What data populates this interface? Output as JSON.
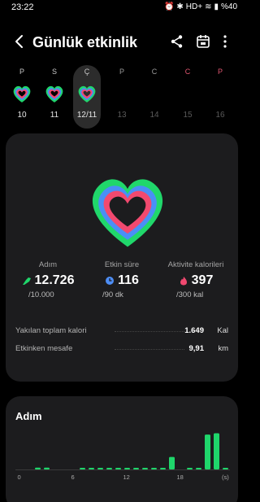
{
  "status": {
    "time": "23:22",
    "network": "HD+",
    "battery": "%40"
  },
  "header": {
    "title": "Günlük etkinlik"
  },
  "week": [
    {
      "letter": "P",
      "num": "10",
      "has_ring": true,
      "selected": false,
      "future": false,
      "weekend": false
    },
    {
      "letter": "S",
      "num": "11",
      "has_ring": true,
      "selected": false,
      "future": false,
      "weekend": false
    },
    {
      "letter": "Ç",
      "num": "12/11",
      "has_ring": true,
      "selected": true,
      "future": false,
      "weekend": false
    },
    {
      "letter": "P",
      "num": "13",
      "has_ring": false,
      "selected": false,
      "future": true,
      "weekend": false
    },
    {
      "letter": "C",
      "num": "14",
      "has_ring": false,
      "selected": false,
      "future": true,
      "weekend": false
    },
    {
      "letter": "C",
      "num": "15",
      "has_ring": false,
      "selected": false,
      "future": true,
      "weekend": true
    },
    {
      "letter": "P",
      "num": "16",
      "has_ring": false,
      "selected": false,
      "future": true,
      "weekend": true
    }
  ],
  "stats": {
    "steps": {
      "label": "Adım",
      "value": "12.726",
      "goal": "/10.000"
    },
    "active_time": {
      "label": "Etkin süre",
      "value": "116",
      "goal": "/90 dk"
    },
    "active_calories": {
      "label": "Aktivite kalorileri",
      "value": "397",
      "goal": "/300 kal"
    }
  },
  "rows": [
    {
      "label": "Yakılan toplam kalori",
      "value": "1.649",
      "unit": "Kal"
    },
    {
      "label": "Etkinken mesafe",
      "value": "9,91",
      "unit": "km"
    }
  ],
  "steps_card": {
    "title": "Adım"
  },
  "colors": {
    "steps_green": "#1fd66b",
    "active_blue": "#4d8df5",
    "calories_pink": "#f0486f"
  },
  "chart_data": {
    "type": "bar",
    "x": [
      0,
      1,
      2,
      3,
      4,
      5,
      6,
      7,
      8,
      9,
      10,
      11,
      12,
      13,
      14,
      15,
      16,
      17,
      18,
      19,
      20,
      21,
      22,
      23
    ],
    "xticks": [
      "0",
      "6",
      "12",
      "18",
      "(s)"
    ],
    "values": [
      0,
      0,
      150,
      150,
      0,
      0,
      0,
      100,
      100,
      100,
      100,
      100,
      100,
      100,
      100,
      100,
      100,
      1000,
      0,
      100,
      100,
      2800,
      2900,
      100
    ],
    "ylim": [
      0,
      3000
    ],
    "color": "#1fd66b"
  }
}
